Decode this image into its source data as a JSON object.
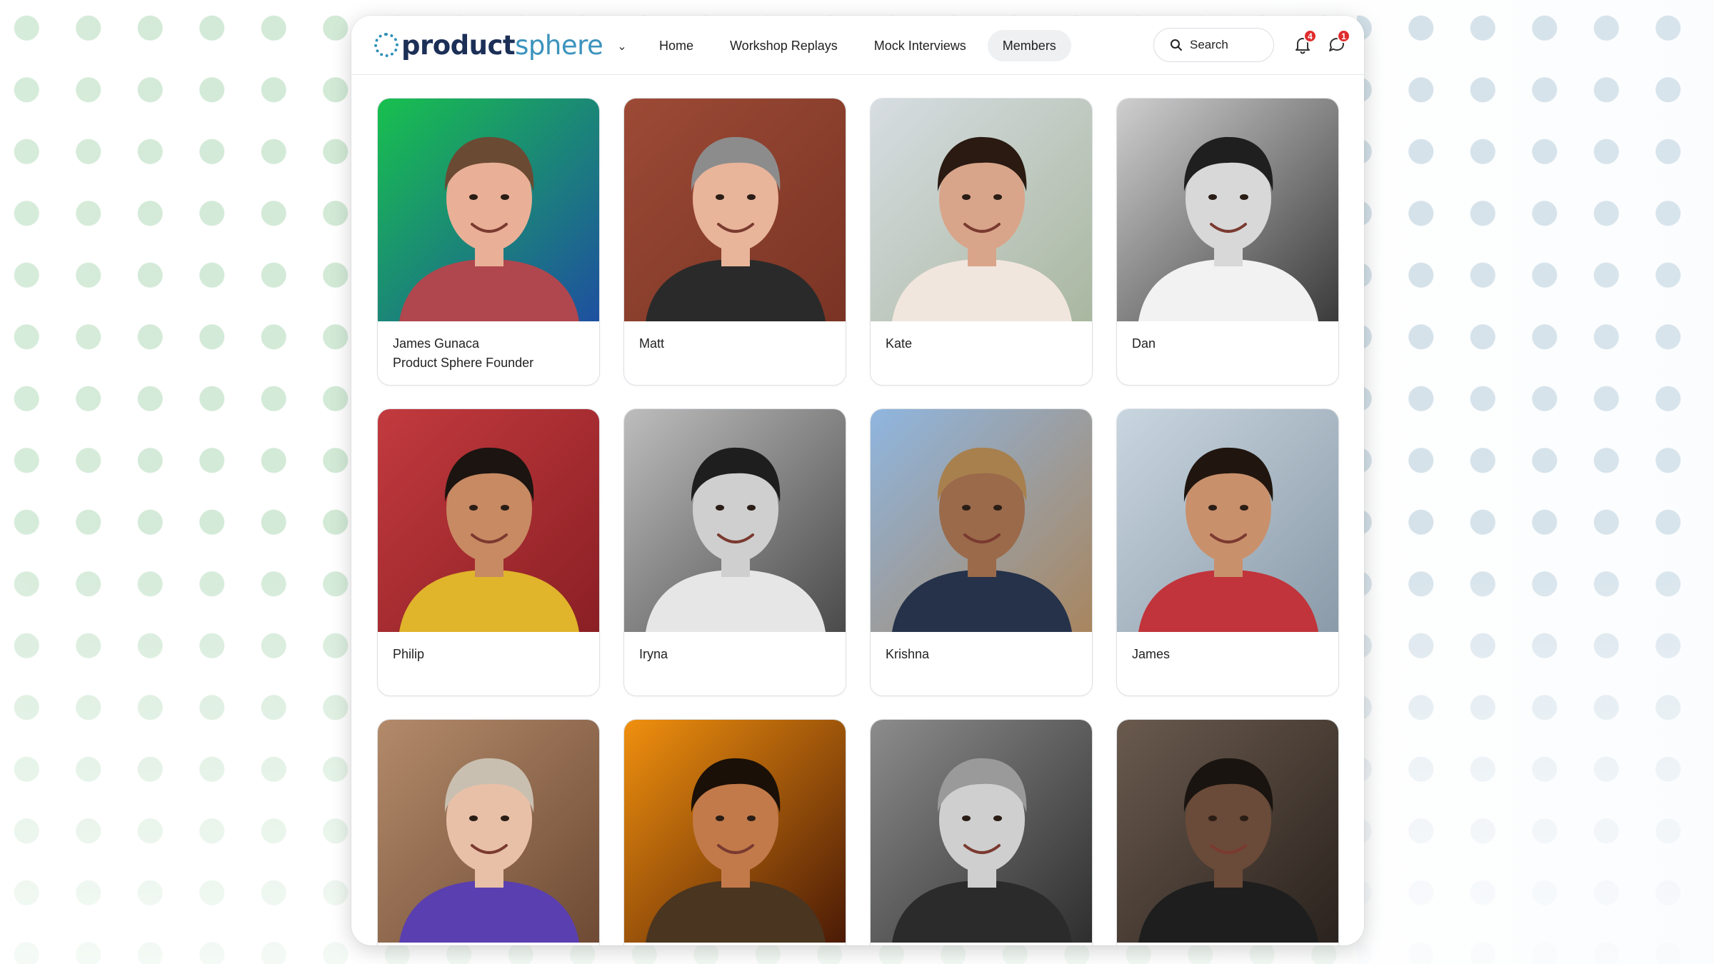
{
  "brand": {
    "name_part1": "product",
    "name_part2": "sphere",
    "caret": "⌄"
  },
  "nav": {
    "items": [
      {
        "label": "Home",
        "active": false
      },
      {
        "label": "Workshop Replays",
        "active": false
      },
      {
        "label": "Mock Interviews",
        "active": false
      },
      {
        "label": "Members",
        "active": true
      }
    ]
  },
  "search": {
    "placeholder": "Search"
  },
  "notifications": {
    "bell_count": "4",
    "chat_count": "1"
  },
  "members": [
    {
      "name": "James Gunaca",
      "title": "Product Sphere Founder",
      "bg": [
        "#18c04e",
        "#1e4fa0"
      ],
      "skin": "#e9b097",
      "hair": "#6b4a33",
      "shirt": "#b0474e"
    },
    {
      "name": "Matt",
      "title": "",
      "bg": [
        "#9c4a36",
        "#7a3424"
      ],
      "skin": "#e8b49a",
      "hair": "#8c8c8c",
      "shirt": "#2a2a2a"
    },
    {
      "name": "Kate",
      "title": "",
      "bg": [
        "#d7dde2",
        "#a9b7a0"
      ],
      "skin": "#d9a58a",
      "hair": "#2a1a12",
      "shirt": "#f1e6de"
    },
    {
      "name": "Dan",
      "title": "",
      "bg": [
        "#cfcfcf",
        "#3a3a3a"
      ],
      "skin": "#d8d8d8",
      "hair": "#1f1f1f",
      "shirt": "#f2f2f2"
    },
    {
      "name": "Philip",
      "title": "",
      "bg": [
        "#c23a3e",
        "#8a1f24"
      ],
      "skin": "#c88a63",
      "hair": "#1c1410",
      "shirt": "#e0b42b"
    },
    {
      "name": "Iryna",
      "title": "",
      "bg": [
        "#bdbdbd",
        "#4a4a4a"
      ],
      "skin": "#cfcfcf",
      "hair": "#1e1e1e",
      "shirt": "#e6e6e6"
    },
    {
      "name": "Krishna",
      "title": "",
      "bg": [
        "#8fb6e0",
        "#a8855e"
      ],
      "skin": "#9a6a4a",
      "hair": "#a8804e",
      "shirt": "#25324a"
    },
    {
      "name": "James",
      "title": "",
      "bg": [
        "#c9d6e0",
        "#8a9aa8"
      ],
      "skin": "#c9906c",
      "hair": "#20160f",
      "shirt": "#c1343b"
    },
    {
      "name": "",
      "title": "",
      "bg": [
        "#b38a6a",
        "#6e4a34"
      ],
      "skin": "#e8c0a8",
      "hair": "#c9bfb0",
      "shirt": "#5a3fb0"
    },
    {
      "name": "",
      "title": "",
      "bg": [
        "#f0900e",
        "#4a1a06"
      ],
      "skin": "#c27a4a",
      "hair": "#1a1008",
      "shirt": "#4a3520"
    },
    {
      "name": "",
      "title": "",
      "bg": [
        "#8c8c8c",
        "#2e2e2e"
      ],
      "skin": "#cfcfcf",
      "hair": "#9a9a9a",
      "shirt": "#2b2b2b"
    },
    {
      "name": "",
      "title": "",
      "bg": [
        "#6a5a4e",
        "#2a221d"
      ],
      "skin": "#6a4a38",
      "hair": "#1a1410",
      "shirt": "#1e1e1e"
    }
  ]
}
